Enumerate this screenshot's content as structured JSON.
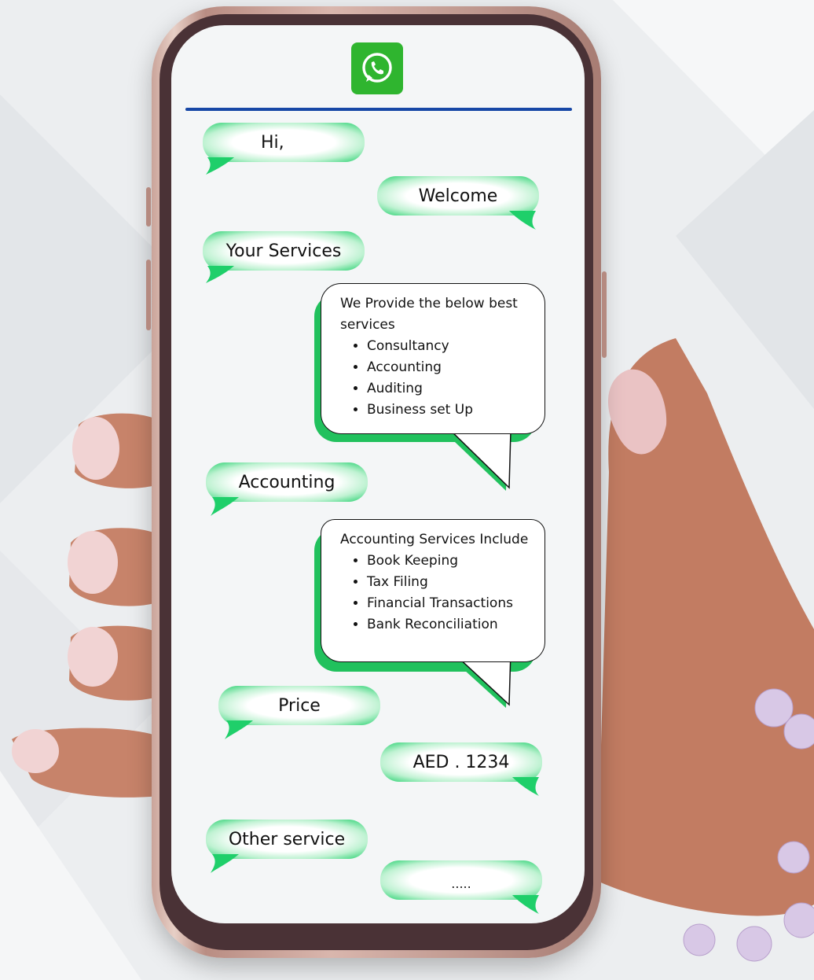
{
  "header": {
    "logo_icon": "whatsapp-icon",
    "accent_color": "#2fb52f",
    "divider_color": "#1747a6"
  },
  "chat": {
    "messages": [
      {
        "side": "left",
        "text": "Hi,"
      },
      {
        "side": "right",
        "text": "Welcome"
      },
      {
        "side": "left",
        "text": "Your Services"
      },
      {
        "side": "right",
        "type": "card",
        "intro": "We Provide the below best services",
        "items": [
          "Consultancy",
          "Accounting",
          "Auditing",
          "Business set Up"
        ]
      },
      {
        "side": "left",
        "text": "Accounting"
      },
      {
        "side": "right",
        "type": "card",
        "intro": "Accounting Services Include",
        "items": [
          "Book Keeping",
          "Tax Filing",
          "Financial Transactions",
          "Bank Reconciliation"
        ]
      },
      {
        "side": "left",
        "text": "Price"
      },
      {
        "side": "right",
        "text": "AED . 1234"
      },
      {
        "side": "left",
        "text": "Other service"
      },
      {
        "side": "right",
        "text": "....."
      }
    ]
  },
  "colors": {
    "bubble_green": "#1fcf6a",
    "card_shadow": "#21c15d"
  }
}
